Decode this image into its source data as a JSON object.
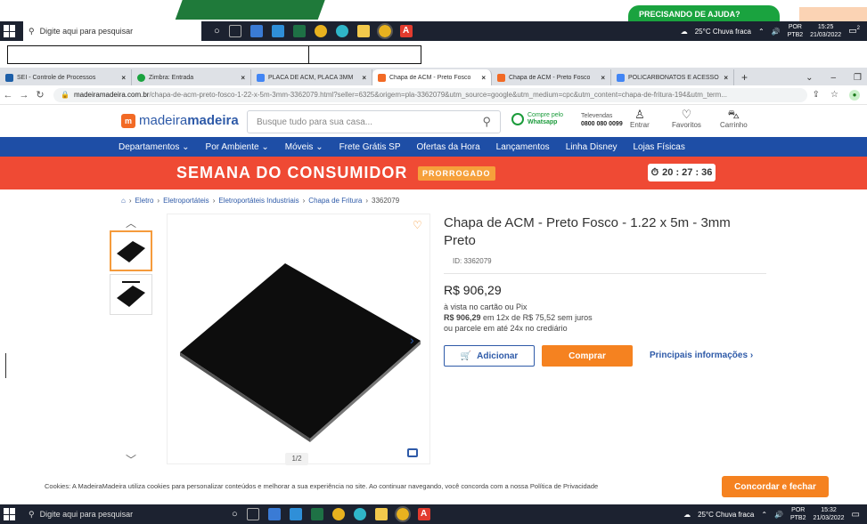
{
  "help_bubble": {
    "label": "PRECISANDO DE AJUDA?"
  },
  "taskbar": {
    "search_placeholder": "Digite aqui para pesquisar",
    "weather": "25°C  Chuva fraca",
    "lang_top": "POR",
    "lang_bottom": "PTB2",
    "top_time": "15:25",
    "top_date": "21/03/2022",
    "bottom_time": "15:32",
    "bottom_date": "21/03/2022",
    "top_notification_count": "2"
  },
  "browser": {
    "tabs": [
      {
        "label": "SEI - Controle de Processos",
        "color": "#1e5fa8"
      },
      {
        "label": "Zimbra: Entrada",
        "color": "#1aa33f"
      },
      {
        "label": "PLACA DE ACM, PLACA 3MM",
        "color": "#4285f4"
      },
      {
        "label": "Chapa de ACM - Preto Fosco",
        "color": "#f26a25"
      },
      {
        "label": "Chapa de ACM - Preto Fosco",
        "color": "#f26a25"
      },
      {
        "label": "POLICARBONATOS E ACESSÓ",
        "color": "#4285f4"
      }
    ],
    "active_tab_index": 3,
    "new_tab": "+",
    "url_domain": "madeiramadeira.com.br",
    "url_rest": "/chapa-de-acm-preto-fosco-1-22-x-5m-3mm-3362079.html?seller=6325&origem=pla-3362079&utm_source=google&utm_medium=cpc&utm_content=chapa-de-fritura-194&utm_term..."
  },
  "header": {
    "logo_part1": "madeira",
    "logo_part2": "madeira",
    "search_placeholder": "Busque tudo para sua casa...",
    "whatsapp_line1": "Compre pelo",
    "whatsapp_line2": "Whatsapp",
    "tele_line1": "Televendas",
    "tele_line2": "0800 080 0099",
    "entrar": "Entrar",
    "favoritos": "Favoritos",
    "carrinho": "Carrinho"
  },
  "nav": {
    "items": [
      "Departamentos ⌄",
      "Por Ambiente ⌄",
      "Móveis ⌄",
      "Frete Grátis SP",
      "Ofertas da Hora",
      "Lançamentos",
      "Linha Disney",
      "Lojas Físicas"
    ]
  },
  "promo": {
    "title": "SEMANA DO CONSUMIDOR",
    "badge": "PRORROGADO",
    "timer": "20 : 27 : 36"
  },
  "breadcrumb": {
    "items": [
      "Eletro",
      "Eletroportáteis",
      "Eletroportáteis Industriais",
      "Chapa de Fritura"
    ],
    "current": "3362079"
  },
  "gallery": {
    "counter": "1/2"
  },
  "product": {
    "title": "Chapa de ACM - Preto Fosco - 1.22 x 5m - 3mm Preto",
    "id_label": "ID: 3362079",
    "price": "R$ 906,29",
    "pay_cash": "à vista no cartão ou Pix",
    "pay_installment_bold": "R$ 906,29",
    "pay_installment_rest": " em 12x de R$ 75,52 sem juros",
    "pay_crediario": "ou parcele em até 24x no crediário",
    "add_label": "Adicionar",
    "buy_label": "Comprar",
    "info_label": "Principais informações ›"
  },
  "cookies": {
    "text": "Cookies: A MadeiraMadeira utiliza cookies para personalizar conteúdos e melhorar a sua experiência no site. Ao continuar navegando, você concorda com a nossa Política de Privacidade",
    "button": "Concordar e fechar"
  },
  "colors": {
    "brand_blue": "#1e4ea6",
    "brand_orange": "#f58220",
    "promo_red": "#ef4a34"
  }
}
